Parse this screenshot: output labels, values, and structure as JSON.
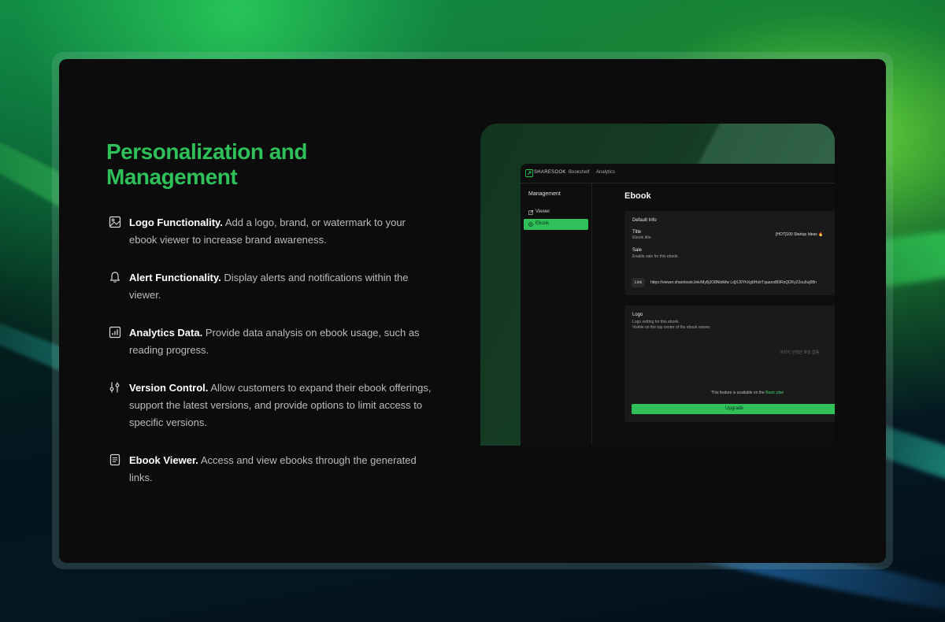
{
  "colors": {
    "accent": "#2fc05a",
    "card_bg": "#0c0c0c",
    "text": "#b9bcbf"
  },
  "section": {
    "title_line1": "Personalization and",
    "title_line2": "Management"
  },
  "features": [
    {
      "icon": "image-icon",
      "title": "Logo Functionality.",
      "desc": "Add a logo, brand, or watermark to your ebook viewer to increase brand awareness."
    },
    {
      "icon": "bell-icon",
      "title": "Alert Functionality.",
      "desc": "Display alerts and notifications within the viewer."
    },
    {
      "icon": "chart-icon",
      "title": "Analytics Data.",
      "desc": "Provide data analysis on ebook usage, such as reading progress."
    },
    {
      "icon": "sliders-icon",
      "title": "Version Control.",
      "desc": "Allow customers to expand their ebook offerings, support the latest versions, and provide options to limit access to specific versions."
    },
    {
      "icon": "document-icon",
      "title": "Ebook Viewer.",
      "desc": "Access and view ebooks through the generated links."
    }
  ],
  "mockup": {
    "brand": "SHARESOOK",
    "nav": [
      "Bookshelf",
      "Analytics"
    ],
    "sidebar": {
      "title": "Management",
      "items": [
        {
          "label": "Viewer",
          "icon": "external-link-icon",
          "active": false
        },
        {
          "label": "Ebook",
          "icon": "gear-icon",
          "active": true
        }
      ]
    },
    "page_title": "Ebook",
    "default_info": {
      "heading": "Default Info",
      "title_label": "Title",
      "title_help": "Ebook title.",
      "title_value": "[HOT]100 Startup Ideas 🔥",
      "sale_label": "Sale",
      "sale_help": "Enable sale for this ebook.",
      "link_label": "Link",
      "link_value": "https://viewer.sharebook.link/My8jJO8Nlolkfw LdjXJ0YhXg6HotrTqaarzd59RsQl2Ky22ou6uj08n"
    },
    "logo_panel": {
      "heading": "Logo",
      "help1": "Logo setting for this ebook.",
      "help2": "Visible on the top center of the ebook viewer.",
      "file_hint": "이미지    선택된 파일 없음",
      "feature_note": "This feature is available on the",
      "plan_link": "Basic plan",
      "upgrade_label": "Upgrade"
    }
  }
}
